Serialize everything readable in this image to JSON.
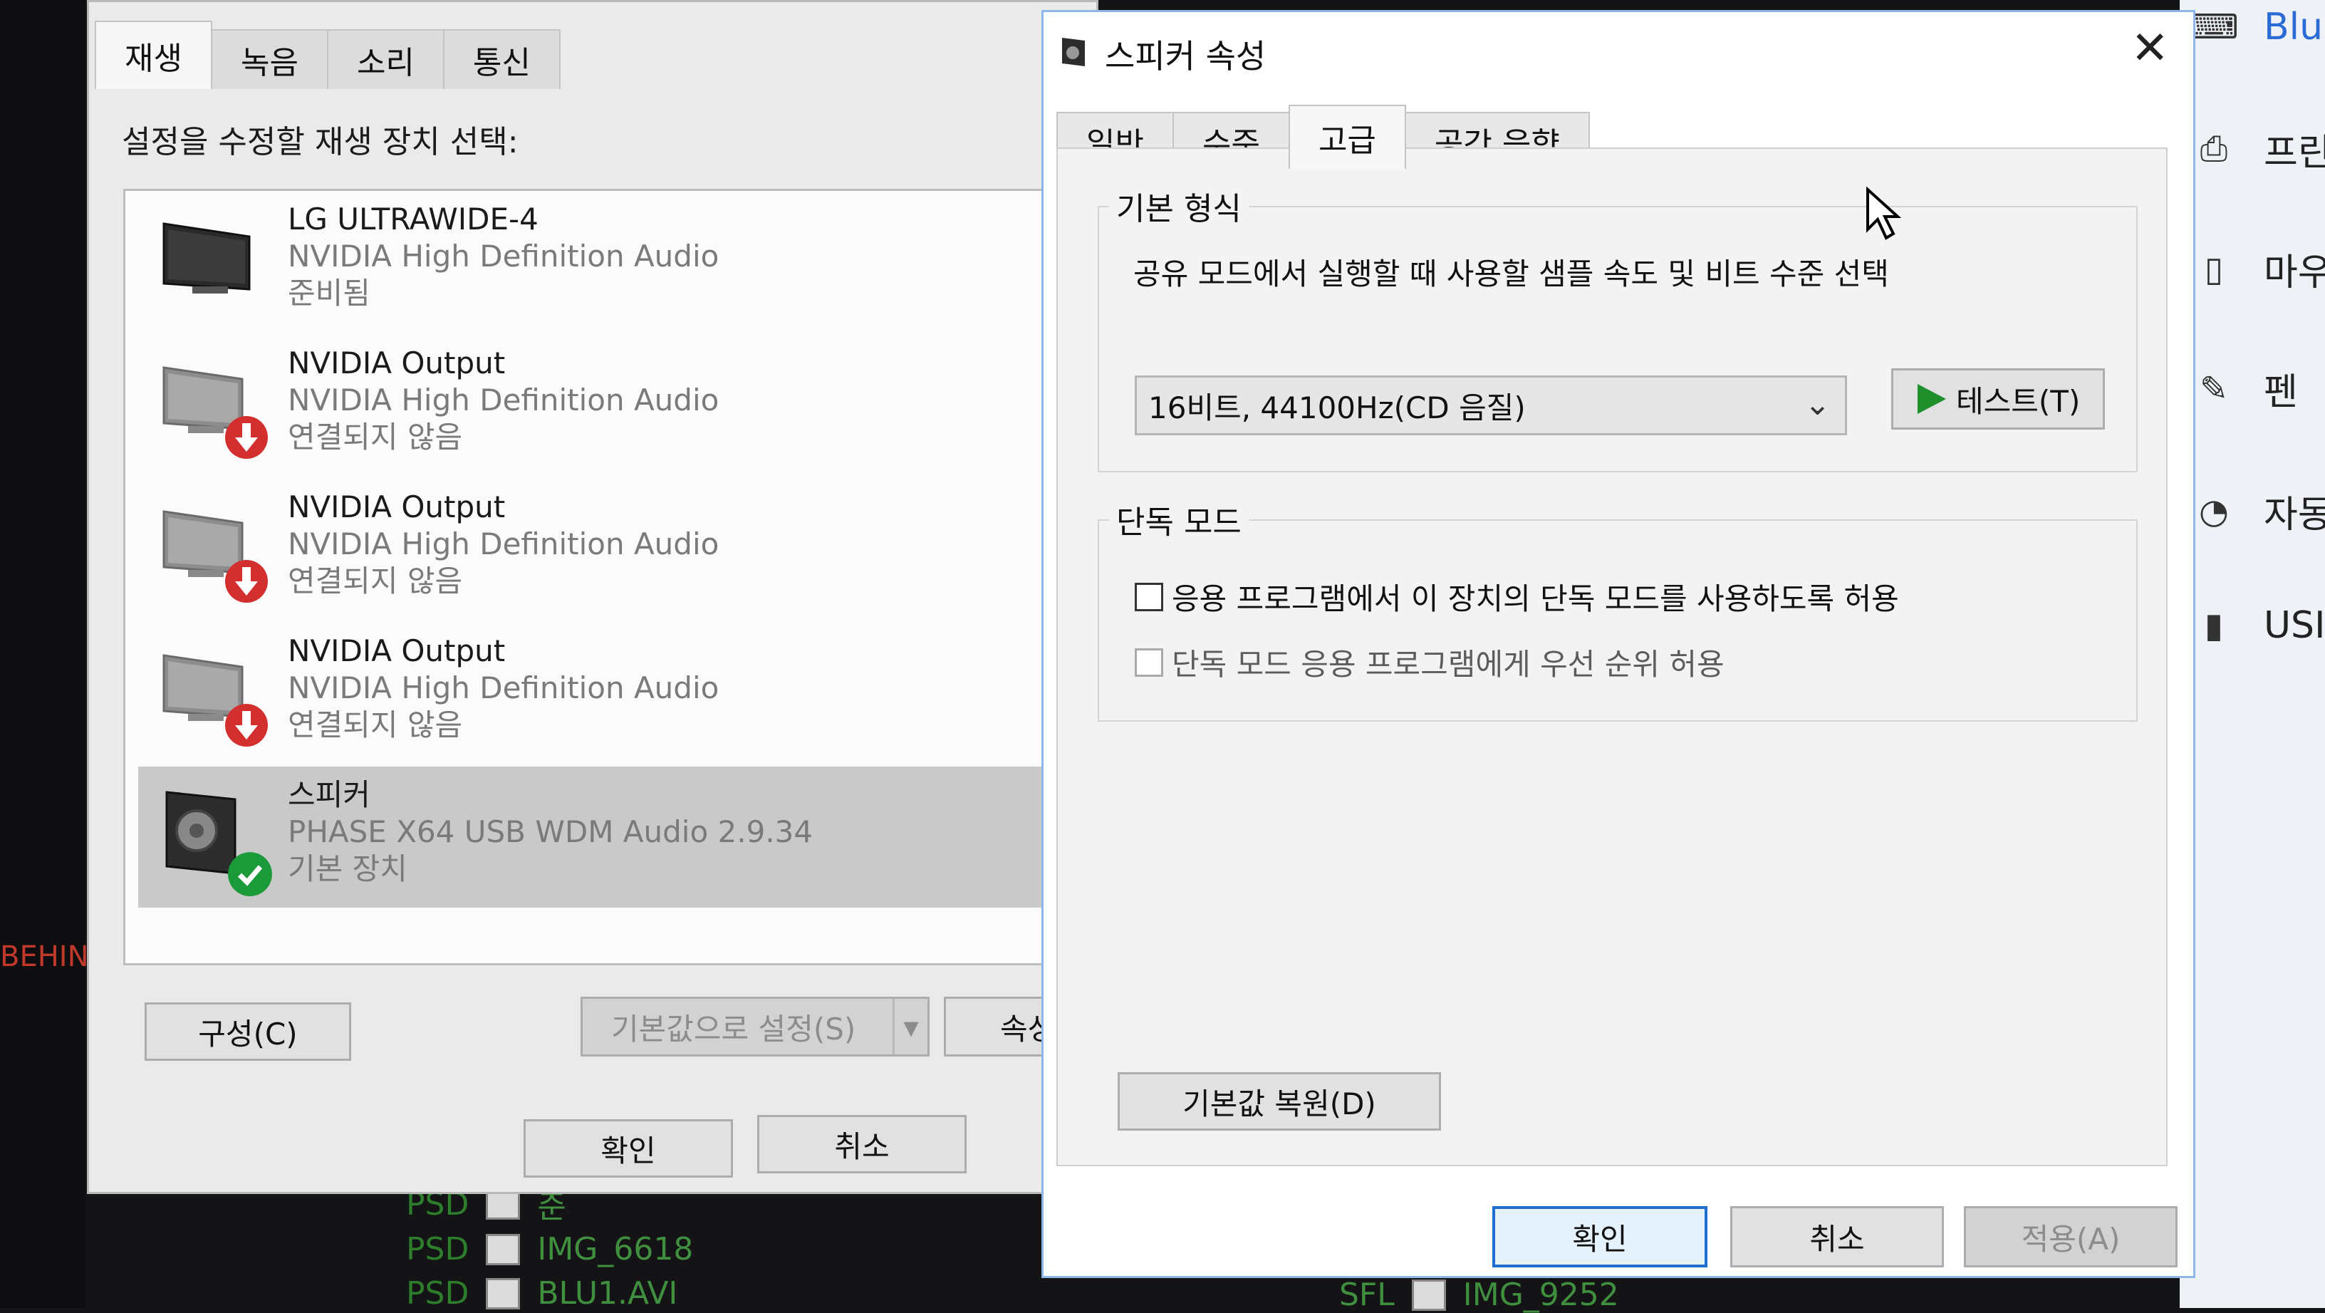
{
  "background": {
    "left_edge_text": "BEHIN",
    "explorer_rows": [
      {
        "type": "PSD",
        "name": "준"
      },
      {
        "type": "PSD",
        "name": "IMG_6618"
      },
      {
        "type": "PSD",
        "name": "BLU1.AVI"
      }
    ],
    "explorer_right": {
      "type": "SFL",
      "name": "IMG_9252"
    }
  },
  "settings_sidebar": {
    "items": [
      {
        "label": "Blu",
        "icon": "keyboard-icon"
      },
      {
        "label": "프린",
        "icon": "printer-icon"
      },
      {
        "label": "마우",
        "icon": "mouse-icon"
      },
      {
        "label": "펜",
        "icon": "pen-icon"
      },
      {
        "label": "자동",
        "icon": "autoplay-icon"
      },
      {
        "label": "USI",
        "icon": "usb-icon"
      }
    ]
  },
  "sound_dialog": {
    "tabs": [
      "재생",
      "녹음",
      "소리",
      "통신"
    ],
    "selected_tab": "재생",
    "prompt": "설정을 수정할 재생 장치 선택:",
    "devices": [
      {
        "name": "LG ULTRAWIDE-4",
        "driver": "NVIDIA High Definition Audio",
        "status": "준비됨",
        "badge": "none"
      },
      {
        "name": "NVIDIA Output",
        "driver": "NVIDIA High Definition Audio",
        "status": "연결되지 않음",
        "badge": "disconnected"
      },
      {
        "name": "NVIDIA Output",
        "driver": "NVIDIA High Definition Audio",
        "status": "연결되지 않음",
        "badge": "disconnected"
      },
      {
        "name": "NVIDIA Output",
        "driver": "NVIDIA High Definition Audio",
        "status": "연결되지 않음",
        "badge": "disconnected"
      },
      {
        "name": "스피커",
        "driver": "PHASE X64 USB WDM Audio 2.9.34",
        "status": "기본 장치",
        "badge": "default"
      }
    ],
    "configure_label": "구성(C)",
    "set_default_label": "기본값으로 설정(S)",
    "properties_label": "속성",
    "ok_label": "확인",
    "cancel_label": "취소"
  },
  "speaker_props": {
    "title": "스피커 속성",
    "tabs": [
      "일반",
      "수준",
      "고급",
      "공간 음향"
    ],
    "selected_tab": "고급",
    "default_format": {
      "group_title": "기본 형식",
      "description": "공유 모드에서 실행할 때 사용할 샘플 속도 및 비트 수준 선택",
      "selected_format": "16비트, 44100Hz(CD 음질)",
      "test_label": "테스트(T)"
    },
    "exclusive_mode": {
      "group_title": "단독 모드",
      "allow_exclusive": "응용 프로그램에서 이 장치의 단독 모드를 사용하도록 허용",
      "allow_exclusive_checked": false,
      "priority": "단독 모드 응용 프로그램에게 우선 순위 허용",
      "priority_checked": false
    },
    "restore_label": "기본값 복원(D)",
    "ok_label": "확인",
    "cancel_label": "취소",
    "apply_label": "적용(A)"
  },
  "colors": {
    "accent": "#1f6fd1",
    "play_green": "#1e8f2a",
    "error_red": "#d32f2f",
    "ok_green": "#1b9a3a"
  }
}
